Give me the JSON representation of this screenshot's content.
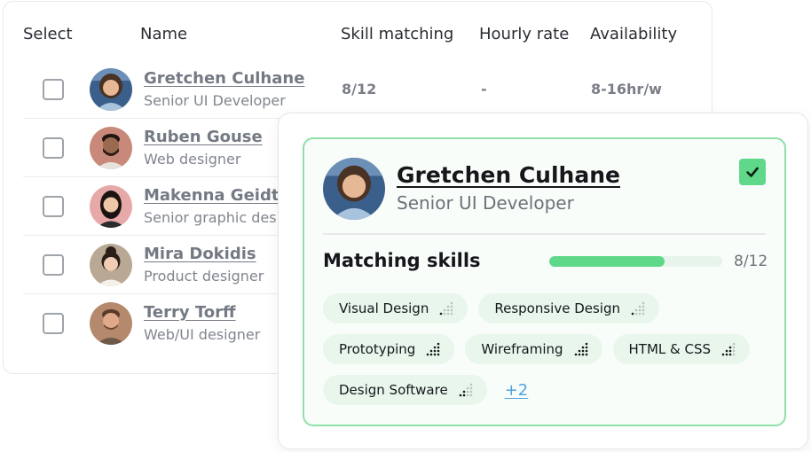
{
  "table": {
    "headers": {
      "select": "Select",
      "name": "Name",
      "skill_matching": "Skill matching",
      "hourly_rate": "Hourly rate",
      "availability": "Availability"
    },
    "rows": [
      {
        "name": "Gretchen Culhane",
        "role": "Senior UI Developer",
        "skill": "8/12",
        "rate": "-",
        "availability": "8-16hr/w",
        "avatar": "avatar-woman-curly"
      },
      {
        "name": "Ruben Gouse",
        "role": "Web designer",
        "avatar": "avatar-man-beard"
      },
      {
        "name": "Makenna Geidt",
        "role": "Senior graphic designer",
        "avatar": "avatar-woman-dark-hair"
      },
      {
        "name": "Mira Dokidis",
        "role": "Product designer",
        "avatar": "avatar-woman-bun"
      },
      {
        "name": "Terry Torff",
        "role": "Web/UI designer",
        "avatar": "avatar-man-short-hair"
      }
    ]
  },
  "detail": {
    "name": "Gretchen Culhane",
    "role": "Senior UI Developer",
    "selected": true,
    "matching_title": "Matching skills",
    "matching_count": "8/12",
    "matching_fraction": 0.667,
    "skills": [
      {
        "label": "Visual Design",
        "level": 1
      },
      {
        "label": "Responsive Design",
        "level": 1
      },
      {
        "label": "Prototyping",
        "level": 4
      },
      {
        "label": "Wireframing",
        "level": 4
      },
      {
        "label": "HTML & CSS",
        "level": 3
      },
      {
        "label": "Design Software",
        "level": 2
      }
    ],
    "more_label": "+2"
  },
  "colors": {
    "accent_green": "#5fd88a",
    "card_border_green": "#8ee0a8",
    "tag_bg": "#e8f6ec",
    "link_blue": "#4ea3e0"
  }
}
